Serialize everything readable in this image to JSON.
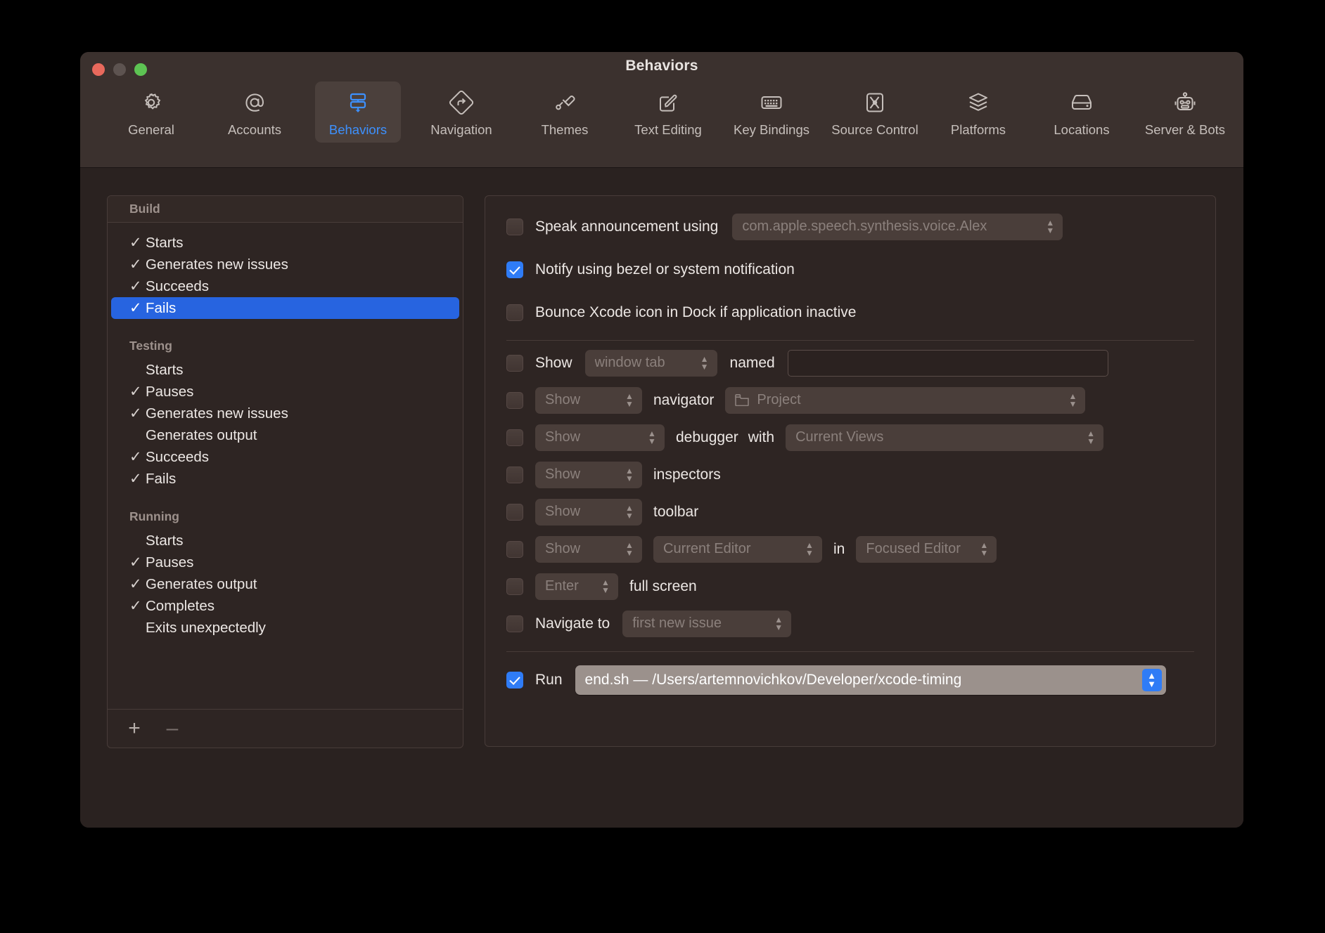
{
  "window": {
    "title": "Behaviors",
    "traffic_lights": [
      "close-button",
      "minimize-button",
      "zoom-button"
    ],
    "accent_blue": "#2f7cf6",
    "selection_blue": "#2764e0"
  },
  "toolbar": {
    "tabs": [
      {
        "label": "General",
        "icon": "gear-icon",
        "selected": false
      },
      {
        "label": "Accounts",
        "icon": "at-sign-icon",
        "selected": false
      },
      {
        "label": "Behaviors",
        "icon": "behaviors-icon",
        "selected": true
      },
      {
        "label": "Navigation",
        "icon": "navigation-sign-icon",
        "selected": false
      },
      {
        "label": "Themes",
        "icon": "paintbrush-icon",
        "selected": false
      },
      {
        "label": "Text Editing",
        "icon": "pencil-square-icon",
        "selected": false
      },
      {
        "label": "Key Bindings",
        "icon": "keyboard-icon",
        "selected": false
      },
      {
        "label": "Source Control",
        "icon": "source-control-icon",
        "selected": false
      },
      {
        "label": "Platforms",
        "icon": "layers-icon",
        "selected": false
      },
      {
        "label": "Locations",
        "icon": "hard-drive-icon",
        "selected": false
      },
      {
        "label": "Server & Bots",
        "icon": "robot-icon",
        "selected": false
      }
    ]
  },
  "sidebar": {
    "header": "Build",
    "groups": [
      {
        "title": "Build",
        "show_title": false,
        "items": [
          {
            "label": "Starts",
            "checked": true,
            "selected": false
          },
          {
            "label": "Generates new issues",
            "checked": true,
            "selected": false
          },
          {
            "label": "Succeeds",
            "checked": true,
            "selected": false
          },
          {
            "label": "Fails",
            "checked": true,
            "selected": true
          }
        ]
      },
      {
        "title": "Testing",
        "show_title": true,
        "items": [
          {
            "label": "Starts",
            "checked": false,
            "selected": false
          },
          {
            "label": "Pauses",
            "checked": true,
            "selected": false
          },
          {
            "label": "Generates new issues",
            "checked": true,
            "selected": false
          },
          {
            "label": "Generates output",
            "checked": false,
            "selected": false
          },
          {
            "label": "Succeeds",
            "checked": true,
            "selected": false
          },
          {
            "label": "Fails",
            "checked": true,
            "selected": false
          }
        ]
      },
      {
        "title": "Running",
        "show_title": true,
        "items": [
          {
            "label": "Starts",
            "checked": false,
            "selected": false
          },
          {
            "label": "Pauses",
            "checked": true,
            "selected": false
          },
          {
            "label": "Generates output",
            "checked": true,
            "selected": false
          },
          {
            "label": "Completes",
            "checked": true,
            "selected": false
          },
          {
            "label": "Exits unexpectedly",
            "checked": false,
            "selected": false
          }
        ]
      }
    ],
    "check_glyph": "✓",
    "add_label": "+",
    "remove_label": "–"
  },
  "panel": {
    "speak": {
      "checked": false,
      "label": "Speak announcement using",
      "voice": "com.apple.speech.synthesis.voice.Alex"
    },
    "notify": {
      "checked": true,
      "label": "Notify using bezel or system notification"
    },
    "bounce": {
      "checked": false,
      "label": "Bounce Xcode icon in Dock if application inactive"
    },
    "window_tab": {
      "checked": false,
      "show_label": "Show",
      "target": "window tab",
      "named_label": "named",
      "name_value": "",
      "name_placeholder": ""
    },
    "navigator": {
      "checked": false,
      "action": "Show",
      "label": "navigator",
      "value": "Project",
      "icon": "folder-icon"
    },
    "debugger": {
      "checked": false,
      "action": "Show",
      "label": "debugger",
      "with_label": "with",
      "value": "Current Views"
    },
    "inspectors": {
      "checked": false,
      "action": "Show",
      "label": "inspectors"
    },
    "toolbar_row": {
      "checked": false,
      "action": "Show",
      "label": "toolbar"
    },
    "editor": {
      "checked": false,
      "action": "Show",
      "which": "Current Editor",
      "in_label": "in",
      "target": "Focused Editor"
    },
    "full_screen": {
      "checked": false,
      "action": "Enter",
      "label": "full screen"
    },
    "navigate": {
      "checked": false,
      "label": "Navigate to",
      "value": "first new issue"
    },
    "run": {
      "checked": true,
      "label": "Run",
      "value": "end.sh — /Users/artemnovichkov/Developer/xcode-timing"
    }
  }
}
